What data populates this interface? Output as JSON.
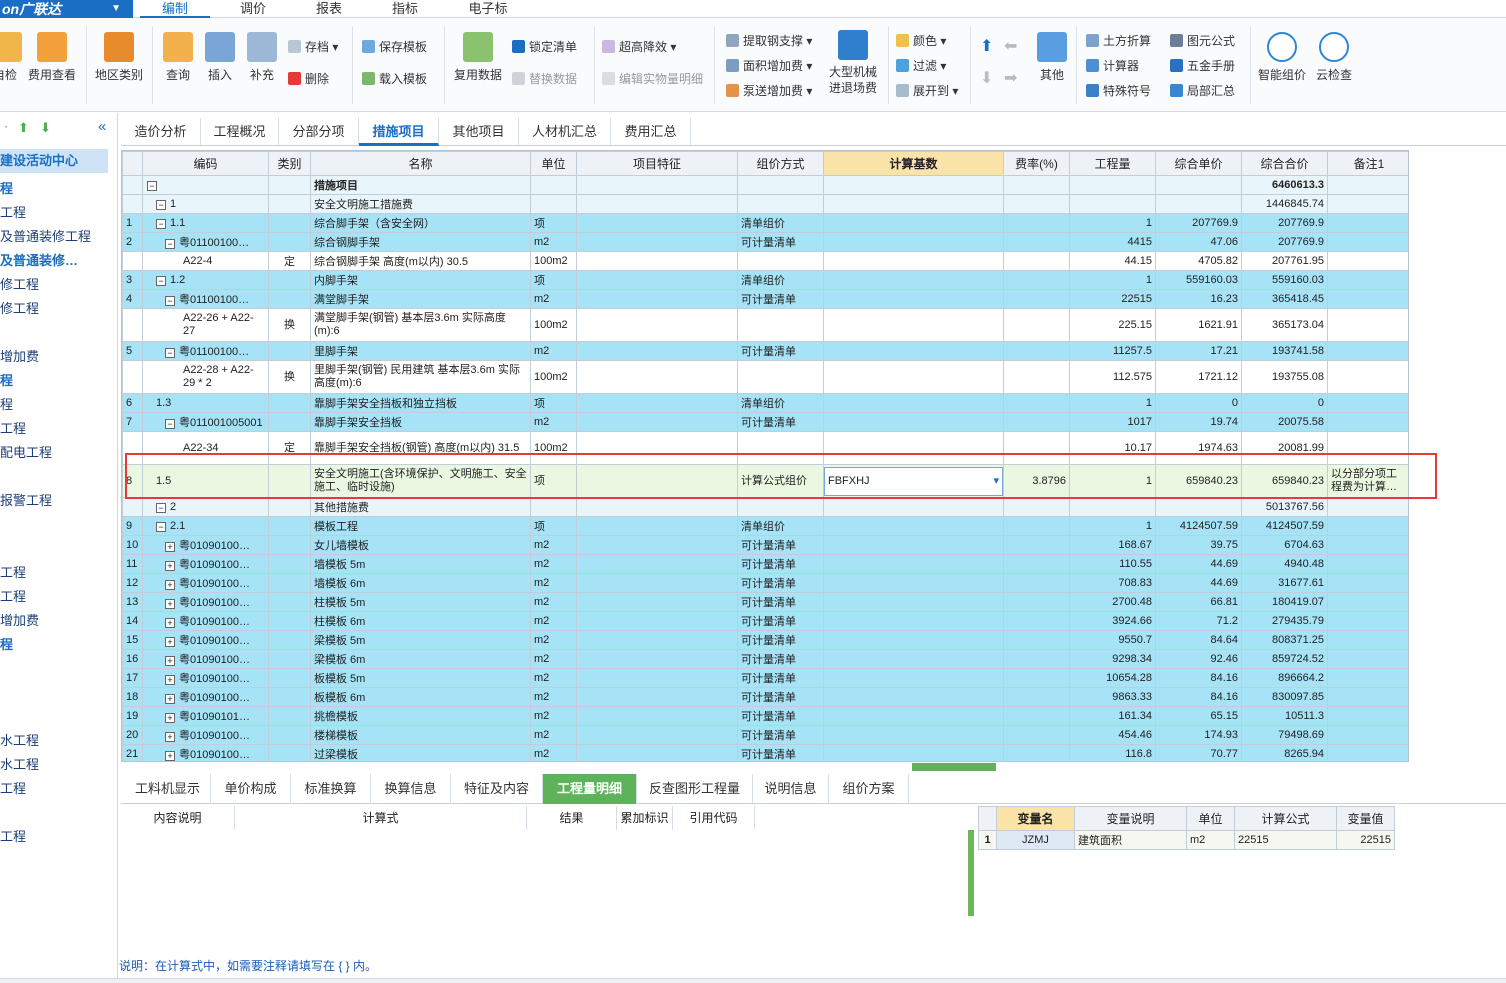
{
  "app": {
    "logo": "on广联达",
    "menu_arrow": "▼"
  },
  "menu": [
    "编制",
    "调价",
    "报表",
    "指标",
    "电子标"
  ],
  "ribbon": {
    "big": [
      "自检",
      "费用查看",
      "地区类别",
      "查询",
      "插入",
      "补充",
      "复用数据",
      "大型机械进退场费",
      "其他",
      "智能组价",
      "云检查"
    ],
    "small": {
      "save": "存档",
      "delete": "删除",
      "save_tpl": "保存模板",
      "load_tpl": "载入模板",
      "lock": "锁定清单",
      "replace": "替换数据",
      "raise": "超高降效",
      "edit_entity": "编辑实物量明细",
      "steel": "提取钢支撑",
      "area_add": "面积增加费",
      "pump_add": "泵送增加费",
      "color": "颜色",
      "filter": "过滤",
      "expand": "展开到",
      "earth": "土方折算",
      "calc": "计算器",
      "special": "特殊符号",
      "formula": "图元公式",
      "hardware": "五金手册",
      "local_sum": "局部汇总"
    }
  },
  "left_panel": {
    "items": [
      "建设活动中心",
      "工程",
      "工程",
      "及普通装修工程",
      "及普通装修",
      "修工程",
      "修工程",
      "增加费",
      "工程",
      "工程",
      "工程",
      "配电工程",
      "报警工程",
      "工程",
      "工程",
      "增加费",
      "程",
      "水工程",
      "水工程",
      "工程",
      "工程"
    ]
  },
  "tabs": [
    "造价分析",
    "工程概况",
    "分部分项",
    "措施项目",
    "其他项目",
    "人材机汇总",
    "费用汇总"
  ],
  "grid": {
    "headers": [
      "编码",
      "类别",
      "名称",
      "单位",
      "项目特征",
      "组价方式",
      "计算基数",
      "费率(%)",
      "工程量",
      "综合单价",
      "综合合价",
      "备注1"
    ],
    "rows": [
      {
        "no": "",
        "code": "",
        "type": "",
        "name": "措施项目",
        "unit": "",
        "method": "",
        "base": "",
        "rate": "",
        "qty": "",
        "price": "",
        "total": "6460613.3",
        "note": ""
      },
      {
        "no": "",
        "code": "1",
        "type": "",
        "name": "安全文明施工措施费",
        "unit": "",
        "method": "",
        "base": "",
        "rate": "",
        "qty": "",
        "price": "",
        "total": "1446845.74",
        "note": ""
      },
      {
        "no": "1",
        "code": "1.1",
        "type": "",
        "name": "综合脚手架（含安全网）",
        "unit": "项",
        "method": "清单组价",
        "base": "",
        "rate": "",
        "qty": "1",
        "price": "207769.9",
        "total": "207769.9",
        "note": ""
      },
      {
        "no": "2",
        "code": "粤01100100…",
        "type": "",
        "name": "综合钢脚手架",
        "unit": "m2",
        "method": "可计量清单",
        "base": "",
        "rate": "",
        "qty": "4415",
        "price": "47.06",
        "total": "207769.9",
        "note": ""
      },
      {
        "no": "",
        "code": "A22-4",
        "type": "定",
        "name": "综合钢脚手架 高度(m以内) 30.5",
        "unit": "100m2",
        "method": "",
        "base": "",
        "rate": "",
        "qty": "44.15",
        "price": "4705.82",
        "total": "207761.95",
        "note": ""
      },
      {
        "no": "3",
        "code": "1.2",
        "type": "",
        "name": "内脚手架",
        "unit": "项",
        "method": "清单组价",
        "base": "",
        "rate": "",
        "qty": "1",
        "price": "559160.03",
        "total": "559160.03",
        "note": ""
      },
      {
        "no": "4",
        "code": "粤01100100…",
        "type": "",
        "name": "满堂脚手架",
        "unit": "m2",
        "method": "可计量清单",
        "base": "",
        "rate": "",
        "qty": "22515",
        "price": "16.23",
        "total": "365418.45",
        "note": ""
      },
      {
        "no": "",
        "code": "A22-26 + A22-27",
        "type": "换",
        "name": "满堂脚手架(钢管) 基本层3.6m 实际高度(m):6",
        "unit": "100m2",
        "method": "",
        "base": "",
        "rate": "",
        "qty": "225.15",
        "price": "1621.91",
        "total": "365173.04",
        "note": ""
      },
      {
        "no": "5",
        "code": "粤01100100…",
        "type": "",
        "name": "里脚手架",
        "unit": "m2",
        "method": "可计量清单",
        "base": "",
        "rate": "",
        "qty": "11257.5",
        "price": "17.21",
        "total": "193741.58",
        "note": ""
      },
      {
        "no": "",
        "code": "A22-28 + A22-29 * 2",
        "type": "换",
        "name": "里脚手架(钢管) 民用建筑 基本层3.6m 实际高度(m):6",
        "unit": "100m2",
        "method": "",
        "base": "",
        "rate": "",
        "qty": "112.575",
        "price": "1721.12",
        "total": "193755.08",
        "note": ""
      },
      {
        "no": "6",
        "code": "1.3",
        "type": "",
        "name": "靠脚手架安全挡板和独立挡板",
        "unit": "项",
        "method": "清单组价",
        "base": "",
        "rate": "",
        "qty": "1",
        "price": "0",
        "total": "0",
        "note": ""
      },
      {
        "no": "7",
        "code": "粤011001005001",
        "type": "",
        "name": "靠脚手架安全挡板",
        "unit": "m2",
        "method": "可计量清单",
        "base": "",
        "rate": "",
        "qty": "1017",
        "price": "19.74",
        "total": "20075.58",
        "note": ""
      },
      {
        "no": "",
        "code": "A22-34",
        "type": "定",
        "name": "靠脚手架安全挡板(钢管) 高度(m以内) 31.5",
        "unit": "100m2",
        "method": "",
        "base": "",
        "rate": "",
        "qty": "10.17",
        "price": "1974.63",
        "total": "20081.99",
        "note": ""
      },
      {
        "no": "8",
        "code": "1.5",
        "type": "",
        "name": "安全文明施工(含环境保护、文明施工、安全施工、临时设施)",
        "unit": "项",
        "method": "计算公式组价",
        "base": "FBFXHJ",
        "rate": "3.8796",
        "qty": "1",
        "price": "659840.23",
        "total": "659840.23",
        "note": "以分部分项工程费为计算…"
      },
      {
        "no": "",
        "code": "2",
        "type": "",
        "name": "其他措施费",
        "unit": "",
        "method": "",
        "base": "",
        "rate": "",
        "qty": "",
        "price": "",
        "total": "5013767.56",
        "note": ""
      },
      {
        "no": "9",
        "code": "2.1",
        "type": "",
        "name": "模板工程",
        "unit": "项",
        "method": "清单组价",
        "base": "",
        "rate": "",
        "qty": "1",
        "price": "4124507.59",
        "total": "4124507.59",
        "note": ""
      },
      {
        "no": "10",
        "code": "粤01090100…",
        "type": "",
        "name": "女儿墙模板",
        "unit": "m2",
        "method": "可计量清单",
        "base": "",
        "rate": "",
        "qty": "168.67",
        "price": "39.75",
        "total": "6704.63",
        "note": ""
      },
      {
        "no": "11",
        "code": "粤01090100…",
        "type": "",
        "name": "墙模板 5m",
        "unit": "m2",
        "method": "可计量清单",
        "base": "",
        "rate": "",
        "qty": "110.55",
        "price": "44.69",
        "total": "4940.48",
        "note": ""
      },
      {
        "no": "12",
        "code": "粤01090100…",
        "type": "",
        "name": "墙模板 6m",
        "unit": "m2",
        "method": "可计量清单",
        "base": "",
        "rate": "",
        "qty": "708.83",
        "price": "44.69",
        "total": "31677.61",
        "note": ""
      },
      {
        "no": "13",
        "code": "粤01090100…",
        "type": "",
        "name": "柱模板 5m",
        "unit": "m2",
        "method": "可计量清单",
        "base": "",
        "rate": "",
        "qty": "2700.48",
        "price": "66.81",
        "total": "180419.07",
        "note": ""
      },
      {
        "no": "14",
        "code": "粤01090100…",
        "type": "",
        "name": "柱模板 6m",
        "unit": "m2",
        "method": "可计量清单",
        "base": "",
        "rate": "",
        "qty": "3924.66",
        "price": "71.2",
        "total": "279435.79",
        "note": ""
      },
      {
        "no": "15",
        "code": "粤01090100…",
        "type": "",
        "name": "梁模板 5m",
        "unit": "m2",
        "method": "可计量清单",
        "base": "",
        "rate": "",
        "qty": "9550.7",
        "price": "84.64",
        "total": "808371.25",
        "note": ""
      },
      {
        "no": "16",
        "code": "粤01090100…",
        "type": "",
        "name": "梁模板 6m",
        "unit": "m2",
        "method": "可计量清单",
        "base": "",
        "rate": "",
        "qty": "9298.34",
        "price": "92.46",
        "total": "859724.52",
        "note": ""
      },
      {
        "no": "17",
        "code": "粤01090100…",
        "type": "",
        "name": "板模板 5m",
        "unit": "m2",
        "method": "可计量清单",
        "base": "",
        "rate": "",
        "qty": "10654.28",
        "price": "84.16",
        "total": "896664.2",
        "note": ""
      },
      {
        "no": "18",
        "code": "粤01090100…",
        "type": "",
        "name": "板模板 6m",
        "unit": "m2",
        "method": "可计量清单",
        "base": "",
        "rate": "",
        "qty": "9863.33",
        "price": "84.16",
        "total": "830097.85",
        "note": ""
      },
      {
        "no": "19",
        "code": "粤01090101…",
        "type": "",
        "name": "挑檐模板",
        "unit": "m2",
        "method": "可计量清单",
        "base": "",
        "rate": "",
        "qty": "161.34",
        "price": "65.15",
        "total": "10511.3",
        "note": ""
      },
      {
        "no": "20",
        "code": "粤01090100…",
        "type": "",
        "name": "楼梯模板",
        "unit": "m2",
        "method": "可计量清单",
        "base": "",
        "rate": "",
        "qty": "454.46",
        "price": "174.93",
        "total": "79498.69",
        "note": ""
      },
      {
        "no": "21",
        "code": "粤01090100…",
        "type": "",
        "name": "过梁模板",
        "unit": "m2",
        "method": "可计量清单",
        "base": "",
        "rate": "",
        "qty": "116.8",
        "price": "70.77",
        "total": "8265.94",
        "note": ""
      }
    ]
  },
  "bottom_tabs": [
    "工料机显示",
    "单价构成",
    "标准换算",
    "换算信息",
    "特征及内容",
    "工程量明细",
    "反查图形工程量",
    "说明信息",
    "组价方案"
  ],
  "detail_headers": [
    "内容说明",
    "计算式",
    "结果",
    "累加标识",
    "引用代码"
  ],
  "vars": {
    "headers": [
      "变量名",
      "变量说明",
      "单位",
      "计算公式",
      "变量值"
    ],
    "rows": [
      {
        "no": "1",
        "name": "JZMJ",
        "desc": "建筑面积",
        "unit": "m2",
        "formula": "22515",
        "value": "22515"
      }
    ]
  },
  "note": "说明：在计算式中，如需要注释请填写在 { } 内。"
}
